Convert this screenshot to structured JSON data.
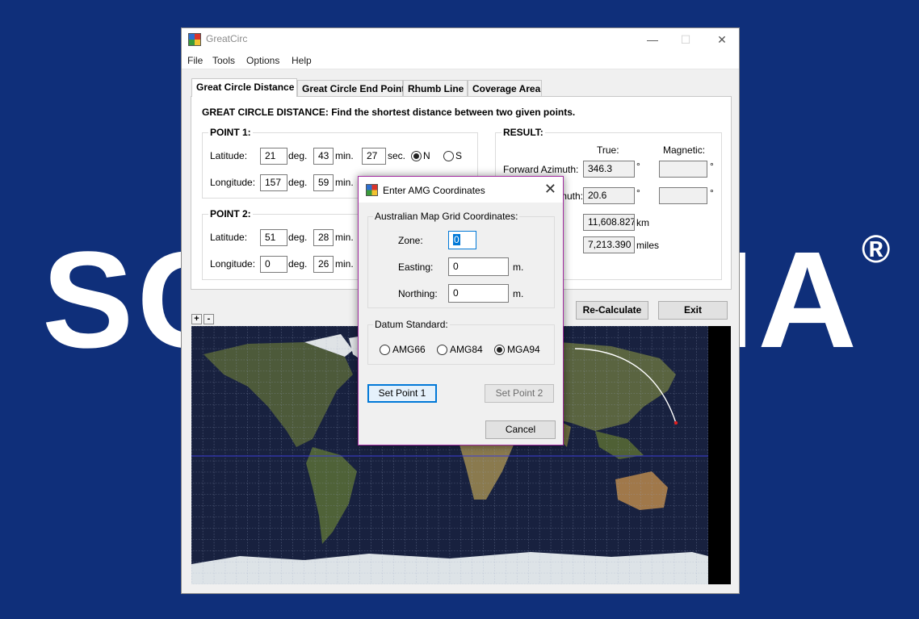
{
  "watermark": {
    "left": "SC",
    "right": "IA",
    "reg": "®"
  },
  "window": {
    "title": "GreatCirc",
    "min_glyph": "—",
    "max_glyph": "☐",
    "close_glyph": "✕"
  },
  "menu": {
    "file": "File",
    "tools": "Tools",
    "options": "Options",
    "help": "Help"
  },
  "tabs": {
    "great_circle_distance": "Great Circle Distance",
    "great_circle_end_point": "Great Circle End Point",
    "rhumb_line": "Rhumb Line",
    "coverage_area": "Coverage Area"
  },
  "panel": {
    "heading": "GREAT CIRCLE DISTANCE: Find the shortest distance between two given points.",
    "point1": {
      "label": "POINT 1:",
      "latitude_label": "Latitude:",
      "lat_deg": "21",
      "lat_min": "43",
      "lat_sec": "27",
      "longitude_label": "Longitude:",
      "lon_deg": "157",
      "lon_min": "59",
      "deg": "deg.",
      "min": "min.",
      "sec": "sec.",
      "north": "N",
      "south": "S"
    },
    "point2": {
      "label": "POINT 2:",
      "latitude_label": "Latitude:",
      "lat_deg": "51",
      "lat_min": "28",
      "longitude_label": "Longitude:",
      "lon_deg": "0",
      "lon_min": "26",
      "deg": "deg.",
      "min": "min."
    },
    "result": {
      "label": "RESULT:",
      "true_header": "True:",
      "magnetic_header": "Magnetic:",
      "forward_azimuth_label": "Forward Azimuth:",
      "forward_azimuth_true": "346.3",
      "back_azimuth_label_partial": "muth:",
      "back_azimuth_true": "20.6",
      "degree_sign": "°",
      "distance_km": "11,608.827",
      "km_unit": "km",
      "distance_miles": "7,213.390",
      "miles_unit": "miles"
    }
  },
  "buttons": {
    "recalculate": "Re-Calculate",
    "exit": "Exit",
    "zoom_in": "+",
    "zoom_out": "-"
  },
  "dialog": {
    "title": "Enter AMG Coordinates",
    "close_glyph": "✕",
    "amg_group_label": "Australian Map Grid Coordinates:",
    "zone_label": "Zone:",
    "zone_value": "0",
    "easting_label": "Easting:",
    "easting_value": "0",
    "easting_unit": "m.",
    "northing_label": "Northing:",
    "northing_value": "0",
    "northing_unit": "m.",
    "datum_group_label": "Datum Standard:",
    "datum_options": [
      "AMG66",
      "AMG84",
      "MGA94"
    ],
    "datum_selected": "MGA94",
    "set_point1": "Set Point 1",
    "set_point2": "Set Point 2",
    "cancel": "Cancel"
  },
  "colors": {
    "background": "#0f2f7a",
    "dialog_border": "#a22ca0",
    "focus_blue": "#0078d7"
  }
}
